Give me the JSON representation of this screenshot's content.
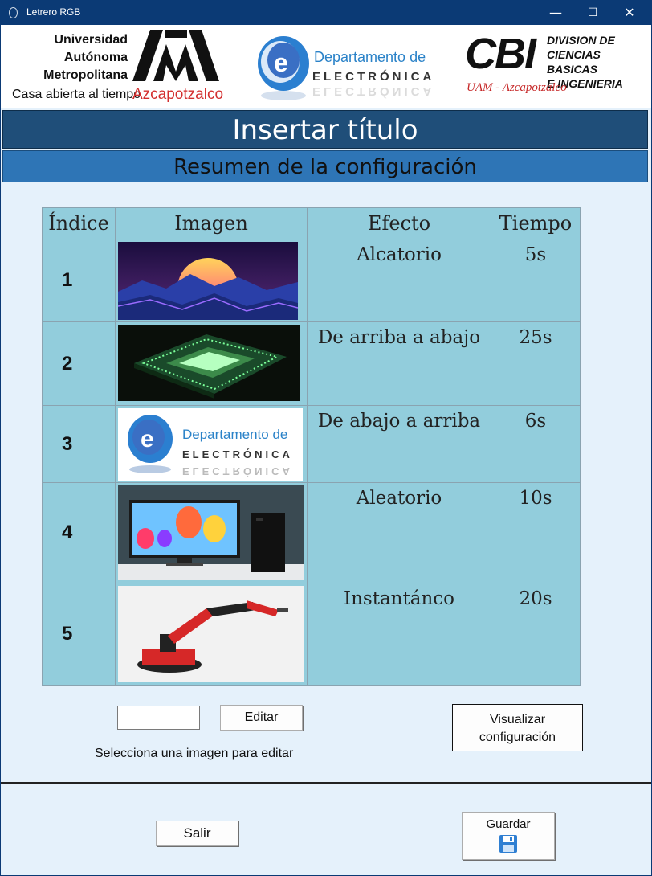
{
  "window": {
    "title": "Letrero RGB",
    "controls": {
      "minimize": "—",
      "maximize": "☐",
      "close": "✕"
    }
  },
  "logos": {
    "uam": {
      "line1": "Universidad",
      "line2": "Autónoma",
      "line3": "Metropolitana",
      "tagline": "Casa abierta al tiempo",
      "campus": "Azcapotzalco"
    },
    "electronica": {
      "line1": "Departamento de",
      "line2": "ELECTRÓNICA",
      "line2_reflection": "ELECTRÓNICA"
    },
    "cbi": {
      "acronym": "CBI",
      "line1": "DIVISION DE",
      "line2": "CIENCIAS BASICAS",
      "line3": "E INGENIERIA",
      "campus": "UAM - Azcapotzalco"
    }
  },
  "header": {
    "title": "Insertar título",
    "subtitle": "Resumen de la configuración"
  },
  "table": {
    "headers": {
      "index": "Índice",
      "image": "Imagen",
      "effect": "Efecto",
      "time": "Tiempo"
    },
    "rows": [
      {
        "index": "1",
        "effect": "Alcatorio",
        "time": "5s",
        "image_icon": "synthwave-sunset-image"
      },
      {
        "index": "2",
        "effect": "De arriba a abajo",
        "time": "25s",
        "image_icon": "glowing-cpu-chip-image"
      },
      {
        "index": "3",
        "effect": "De abajo a arriba",
        "time": "6s",
        "image_icon": "departamento-electronica-logo-image"
      },
      {
        "index": "4",
        "effect": "Aleatorio",
        "time": "10s",
        "image_icon": "monitor-balloons-pc-image"
      },
      {
        "index": "5",
        "effect": "Instantánco",
        "time": "20s",
        "image_icon": "robotic-arm-image"
      }
    ]
  },
  "controls": {
    "edit_input_value": "",
    "edit_button": "Editar",
    "hint": "Selecciona una imagen para editar",
    "visualize_button_line1": "Visualizar",
    "visualize_button_line2": "configuración",
    "exit_button": "Salir",
    "save_button": "Guardar",
    "save_icon": "floppy-disk-icon"
  },
  "colors": {
    "titlebar": "#0b3a75",
    "title_bar": "#1f4e79",
    "subtitle_bar": "#2e75b6",
    "table_bg": "#92cddc",
    "window_bg": "#e5f1fb"
  }
}
